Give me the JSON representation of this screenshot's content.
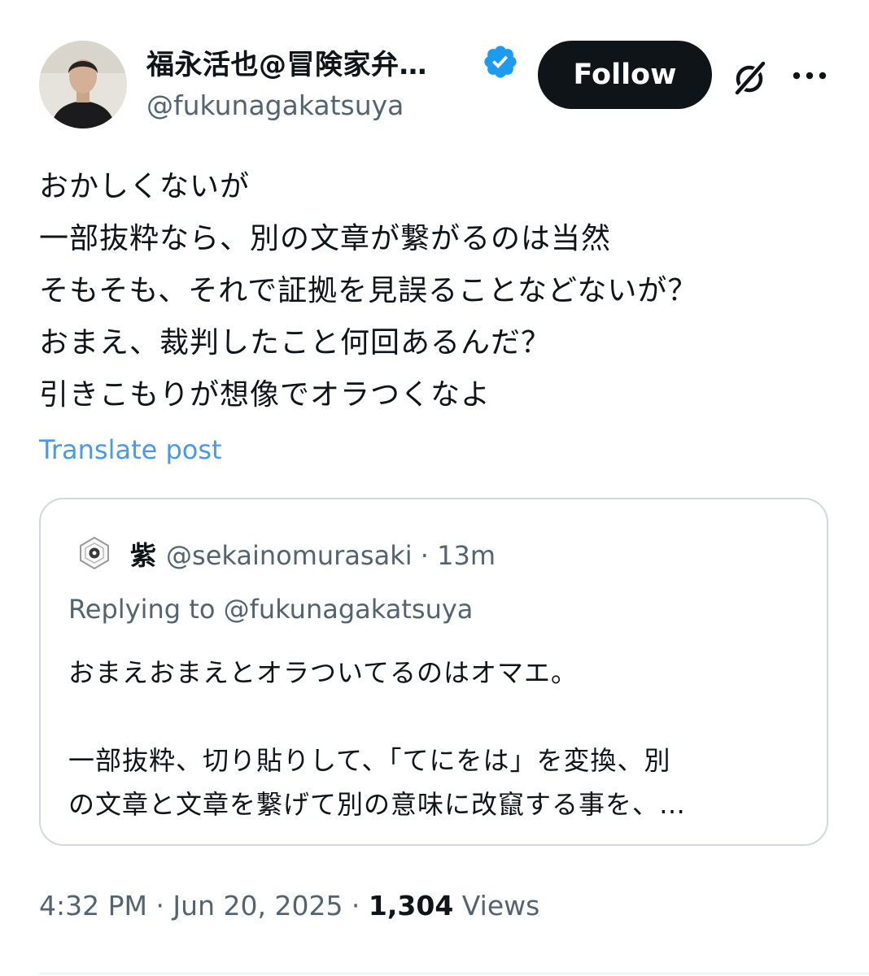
{
  "author": {
    "display_name": "福永活也@冒険家弁…",
    "handle": "@fukunagakatsuya",
    "verified": true
  },
  "actions": {
    "follow_label": "Follow",
    "grok_icon": "grok-icon",
    "more_icon": "more-icon"
  },
  "tweet": {
    "lines": [
      "おかしくないが",
      "一部抜粋なら、別の文章が繋がるのは当然",
      "そもそも、それで証拠を見誤ることなどないが？",
      "おまえ、裁判したこと何回あるんだ？",
      "引きこもりが想像でオラつくなよ"
    ],
    "translate_label": "Translate post"
  },
  "quote": {
    "name": "紫",
    "handle_time": "@sekainomurasaki · 13m",
    "replying_to": "Replying to @fukunagakatsuya",
    "lines": [
      "おまえおまえとオラついてるのはオマエ。",
      "",
      "一部抜粋、切り貼りして、「てにをは」を変換、別",
      "の文章と文章を繋げて別の意味に改竄する事を、…"
    ]
  },
  "meta": {
    "timestamp": "4:32 PM · Jun 20, 2025 · ",
    "views_count": "1,304",
    "views_label": " Views"
  },
  "colors": {
    "accent": "#1d9bf0",
    "link": "#4a99e9",
    "secondary_text": "#536471",
    "primary_text": "#0f1419",
    "border": "#cfd9de"
  }
}
